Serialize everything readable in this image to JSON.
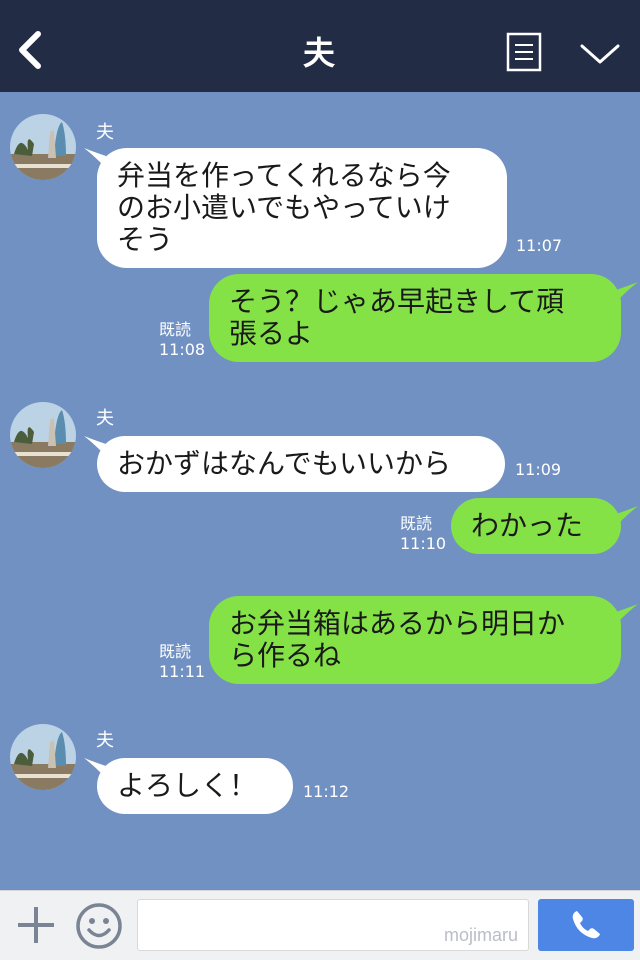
{
  "header": {
    "title": "夫",
    "back_icon": "chevron-left-icon",
    "menu_icon": "list-icon",
    "dropdown_icon": "chevron-down-icon"
  },
  "colors": {
    "header_bg": "#222c45",
    "chat_bg": "#7191c3",
    "incoming_bubble": "#ffffff",
    "outgoing_bubble": "#84e246",
    "call_button": "#4e86e6"
  },
  "messages": [
    {
      "direction": "in",
      "sender": "夫",
      "lines": [
        "弁当を作ってくれるなら今",
        "のお小遣いでもやっていけ",
        "そう"
      ],
      "time": "11:07"
    },
    {
      "direction": "out",
      "read": "既読",
      "lines": [
        "そう？じゃあ早起きして頑",
        "張るよ"
      ],
      "time": "11:08"
    },
    {
      "direction": "in",
      "sender": "夫",
      "lines": [
        "おかずはなんでもいいから"
      ],
      "time": "11:09"
    },
    {
      "direction": "out",
      "read": "既読",
      "lines": [
        "わかった"
      ],
      "time": "11:10"
    },
    {
      "direction": "out",
      "read": "既読",
      "lines": [
        "お弁当箱はあるから明日か",
        "ら作るね"
      ],
      "time": "11:11"
    },
    {
      "direction": "in",
      "sender": "夫",
      "lines": [
        "よろしく！"
      ],
      "time": "11:12"
    }
  ],
  "input": {
    "placeholder": "",
    "watermark": "mojimaru"
  },
  "bottom": {
    "plus_icon": "plus-icon",
    "emoji_icon": "smiley-icon",
    "call_icon": "phone-icon"
  }
}
